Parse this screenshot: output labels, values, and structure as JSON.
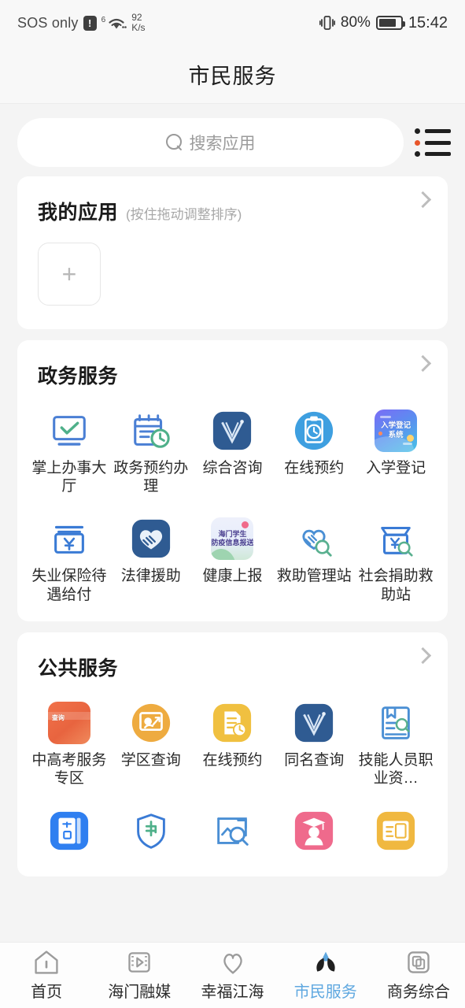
{
  "status_bar": {
    "carrier": "SOS only",
    "warning_badge": "!",
    "wifi_generation": "6",
    "net_speed_value": "92",
    "net_speed_unit": "K/s",
    "battery_percent": "80%",
    "battery_level": 80,
    "clock": "15:42",
    "vibrate_icon": "vibrate-icon"
  },
  "header": {
    "title": "市民服务"
  },
  "search": {
    "placeholder": "搜索应用",
    "icon": "search-icon",
    "list_button_icon": "list-view-icon",
    "list_accent_color": "#e8552a"
  },
  "my_apps": {
    "title": "我的应用",
    "subtitle": "(按住拖动调整排序)",
    "more_icon": "chevron-right-icon",
    "add_label": "+"
  },
  "sections": [
    {
      "title": "政务服务",
      "more_icon": "chevron-right-icon",
      "apps": [
        {
          "label": "掌上办事大厅",
          "icon": "monitor-check-icon",
          "color": "#4a7fd4"
        },
        {
          "label": "政务预约办理",
          "icon": "calendar-clock-icon",
          "color": "#4a7fd4"
        },
        {
          "label": "综合咨询",
          "icon": "v-app-icon",
          "color": "#2f5b92"
        },
        {
          "label": "在线预约",
          "icon": "clipboard-clock-circle-icon",
          "color": "#3e9fe0"
        },
        {
          "label": "入学登记",
          "icon": "enrollment-card-icon",
          "color": "#6a7ef0",
          "tile_text": "入学登记\n系统"
        },
        {
          "label": "失业保险待遇给付",
          "icon": "yuan-box-icon",
          "color": "#3a7bd5"
        },
        {
          "label": "法律援助",
          "icon": "handshake-heart-filled-icon",
          "color": "#2f5b92"
        },
        {
          "label": "健康上报",
          "icon": "health-report-card-icon",
          "color": "#6f62b8",
          "tile_text": "海门学生\n防疫信息报送"
        },
        {
          "label": "救助管理站",
          "icon": "handshake-search-icon",
          "color": "#4a8fd4"
        },
        {
          "label": "社会捐助救助站",
          "icon": "donation-box-search-icon",
          "color": "#3a7bd5"
        }
      ]
    },
    {
      "title": "公共服务",
      "more_icon": "chevron-right-icon",
      "apps": [
        {
          "label": "中高考服务专区",
          "icon": "exam-zone-card-icon",
          "color": "#ea6a41",
          "tile_text": "查询"
        },
        {
          "label": "学区查询",
          "icon": "blackboard-circle-icon",
          "color": "#eeab40"
        },
        {
          "label": "在线预约",
          "icon": "document-clock-icon",
          "color": "#f0c040"
        },
        {
          "label": "同名查询",
          "icon": "v-app-icon",
          "color": "#2f5b92"
        },
        {
          "label": "技能人员职业资…",
          "icon": "book-search-icon",
          "color": "#4a8fd4"
        },
        {
          "label": "",
          "icon": "household-card-icon",
          "color": "#2f7ff0"
        },
        {
          "label": "",
          "icon": "subsidy-shield-icon",
          "color": "#3a7bd5"
        },
        {
          "label": "",
          "icon": "image-search-icon",
          "color": "#4a8fd4"
        },
        {
          "label": "",
          "icon": "graduate-avatar-icon",
          "color": "#ef6a8c"
        },
        {
          "label": "",
          "icon": "id-card-icon",
          "color": "#f0b840"
        }
      ]
    }
  ],
  "tabbar": {
    "active_color": "#5fa8e0",
    "items": [
      {
        "label": "首页",
        "icon": "home-icon",
        "active": false
      },
      {
        "label": "海门融媒",
        "icon": "media-play-icon",
        "active": false
      },
      {
        "label": "幸福江海",
        "icon": "heart-pin-icon",
        "active": false
      },
      {
        "label": "市民服务",
        "icon": "leaf-drop-icon",
        "active": true
      },
      {
        "label": "商务综合",
        "icon": "copy-squares-icon",
        "active": false
      }
    ]
  }
}
